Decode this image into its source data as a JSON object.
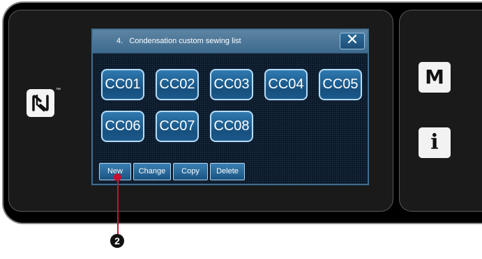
{
  "dialog": {
    "title": "4.   Condensation custom sewing list",
    "close_label": "✕"
  },
  "cc_buttons": [
    "CC01",
    "CC02",
    "CC03",
    "CC04",
    "CC05",
    "CC06",
    "CC07",
    "CC08"
  ],
  "actions": {
    "new": "New",
    "change": "Change",
    "copy": "Copy",
    "delete": "Delete"
  },
  "panel": {
    "m_label": "M",
    "info_label": "i",
    "nfc_tm": "™"
  },
  "callout": {
    "number": "2"
  }
}
